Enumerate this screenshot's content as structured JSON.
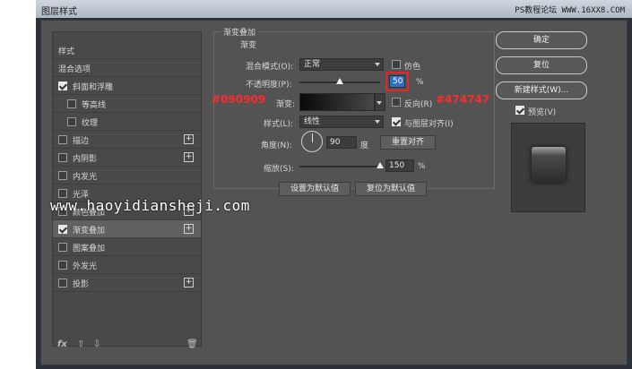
{
  "window": {
    "title": "图层样式",
    "watermark": "PS教程论坛 WWW.16XX8.COM"
  },
  "left_panel": {
    "items": [
      {
        "label": "样式",
        "has_checkbox": false,
        "checked": false,
        "has_plus": false,
        "active": false,
        "indent": 0
      },
      {
        "label": "混合选项",
        "has_checkbox": false,
        "checked": false,
        "has_plus": false,
        "active": false,
        "indent": 0
      },
      {
        "label": "斜面和浮雕",
        "has_checkbox": true,
        "checked": true,
        "has_plus": false,
        "active": false,
        "indent": 0
      },
      {
        "label": "等高线",
        "has_checkbox": true,
        "checked": false,
        "has_plus": false,
        "active": false,
        "indent": 1
      },
      {
        "label": "纹理",
        "has_checkbox": true,
        "checked": false,
        "has_plus": false,
        "active": false,
        "indent": 1
      },
      {
        "label": "描边",
        "has_checkbox": true,
        "checked": false,
        "has_plus": true,
        "active": false,
        "indent": 0
      },
      {
        "label": "内阴影",
        "has_checkbox": true,
        "checked": false,
        "has_plus": true,
        "active": false,
        "indent": 0
      },
      {
        "label": "内发光",
        "has_checkbox": true,
        "checked": false,
        "has_plus": false,
        "active": false,
        "indent": 0
      },
      {
        "label": "光泽",
        "has_checkbox": true,
        "checked": false,
        "has_plus": false,
        "active": false,
        "indent": 0
      },
      {
        "label": "颜色叠加",
        "has_checkbox": true,
        "checked": false,
        "has_plus": true,
        "active": false,
        "indent": 0
      },
      {
        "label": "渐变叠加",
        "has_checkbox": true,
        "checked": true,
        "has_plus": true,
        "active": true,
        "indent": 0
      },
      {
        "label": "图案叠加",
        "has_checkbox": true,
        "checked": false,
        "has_plus": false,
        "active": false,
        "indent": 0
      },
      {
        "label": "外发光",
        "has_checkbox": true,
        "checked": false,
        "has_plus": false,
        "active": false,
        "indent": 0
      },
      {
        "label": "投影",
        "has_checkbox": true,
        "checked": false,
        "has_plus": true,
        "active": false,
        "indent": 0
      }
    ],
    "plus_glyph": "+",
    "footer": {
      "fx": "fx",
      "up": "⇧",
      "down": "⇩",
      "trash": "🗑"
    }
  },
  "gradient_overlay": {
    "group_title": "渐变叠加",
    "sub_title": "渐变",
    "blend_mode_label": "混合模式(O):",
    "blend_mode_value": "正常",
    "dither_label": "仿色",
    "dither_checked": false,
    "opacity_label": "不透明度(P):",
    "opacity_value": "50",
    "opacity_percent": 50,
    "percent": "%",
    "gradient_label": "渐变:",
    "reverse_label": "反向(R)",
    "reverse_checked": false,
    "style_label": "样式(L):",
    "style_value": "线性",
    "align_label": "与图层对齐(I)",
    "align_checked": true,
    "angle_label": "角度(N):",
    "angle_value": "90",
    "angle_unit": "度",
    "reset_align_button": "重置对齐",
    "scale_label": "缩放(S):",
    "scale_value": "150",
    "scale_percent": 150,
    "set_default_button": "设置为默认值",
    "reset_default_button": "复位为默认值"
  },
  "annotations": {
    "left_color": "#090909",
    "right_color": "#474747"
  },
  "site_watermark": "www.haoyidiansheji.com",
  "right_panel": {
    "ok_button": "确定",
    "reset_button": "复位",
    "new_style_button": "新建样式(W)...",
    "preview_label": "预览(V)",
    "preview_checked": true
  },
  "colors": {
    "gradient_start": "#090909",
    "gradient_end": "#474747",
    "annotation_red": "#ff2a2a",
    "selection_blue": "#2f6fce"
  }
}
